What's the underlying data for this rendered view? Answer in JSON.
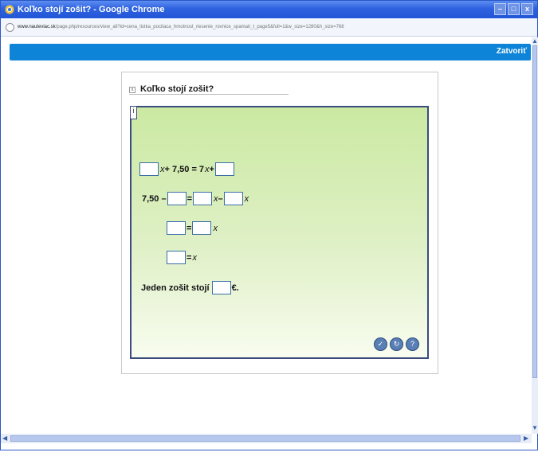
{
  "window": {
    "title": "Koľko stojí zošit? - Google Chrome",
    "controls": [
      "–",
      "□",
      "x"
    ]
  },
  "address": {
    "domain": "www.nauteviac.sk",
    "path": "/page.php/resources/view_all?id=cena_listka_pocitaca_hmotnost_riesenie_rovnice_spamati_t_page5&full=1&w_size=1280&h_size=768"
  },
  "header": {
    "close_label": "Zatvoriť"
  },
  "exercise": {
    "title": "Koľko stojí zošit?",
    "info_label": "i",
    "row1": {
      "op1": "+ 7,50 = 7",
      "var": "x",
      "op2": "+"
    },
    "row2": {
      "lead": "7,50 –",
      "eq": "=",
      "var1": "x",
      "minus": "–",
      "var2": "x"
    },
    "row3": {
      "eq": "=",
      "var": "x"
    },
    "row4": {
      "eq": "= ",
      "var": "x"
    },
    "row5": {
      "lead": "Jeden zošit stojí",
      "unit": "€."
    }
  },
  "tools": [
    "check-icon",
    "refresh-icon",
    "hint-icon"
  ]
}
